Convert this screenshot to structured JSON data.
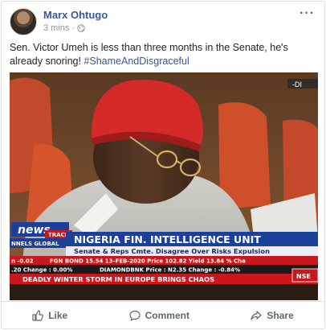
{
  "post": {
    "author": "Marx Ohtugo",
    "time": "3 mins",
    "separator": "·",
    "text_main": "Sen. Victor Umeh is less than three months in the Senate, he's already snoring! ",
    "hashtag": "#ShameAndDisgraceful"
  },
  "video_overlay": {
    "logo_top": "news",
    "logo_bottom": "TRACK",
    "network": "NNELS GLOBAL",
    "headline": "NIGERIA FIN. INTELLIGENCE UNIT",
    "subheadline": "Senate & Reps Cmte. Disagree Over Risks Expulsion",
    "ticker_row1_left": "n -0.02",
    "ticker_row1": "FGN BOND 15.54 13-FEB-2020 Price 102.82 Yield 13.84 % Cha",
    "ticker_row2_left": ".20 Change : 0.00%",
    "ticker_row2": "DIAMONDBNK Price : N2.35 Change : -0.84%",
    "ticker_row3": "DEADLY WINTER STORM IN EUROPE BRINGS CHAOS",
    "corner_badge": "NSE",
    "corner_tag": "-DI",
    "colors": {
      "banner_blue": "#1c3f9c",
      "ticker_red": "#c8171d",
      "ticker_dark": "#1a1a1a"
    }
  },
  "actions": {
    "like": "Like",
    "comment": "Comment",
    "share": "Share"
  },
  "icons": {
    "more": "more-options-icon",
    "globe": "globe-icon",
    "like": "thumbs-up-icon",
    "comment": "speech-bubble-icon",
    "share": "share-arrow-icon"
  }
}
